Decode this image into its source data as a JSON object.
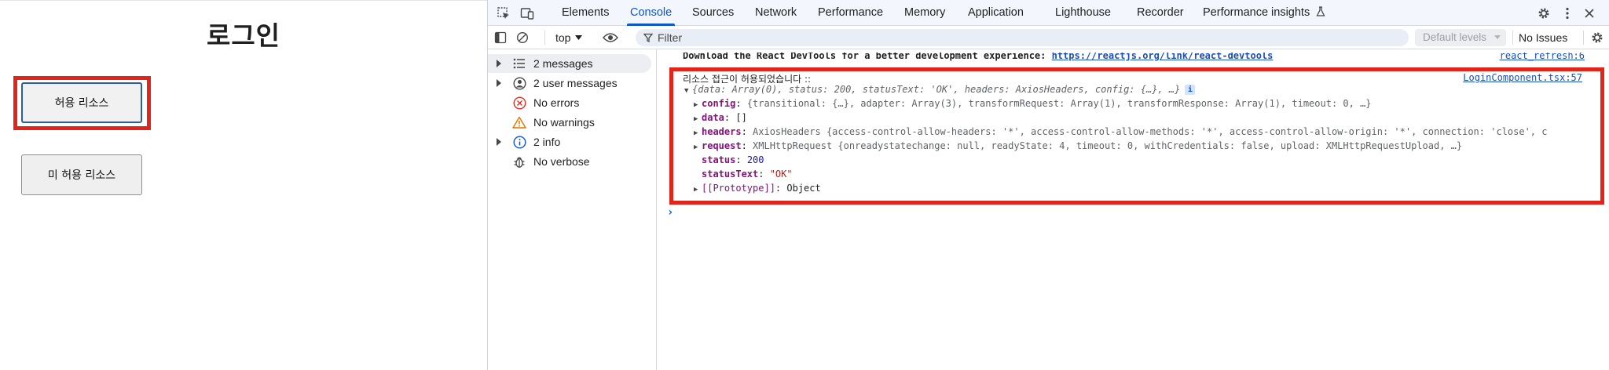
{
  "app": {
    "title": "로그인",
    "buttons": {
      "allowed": "허용 리소스",
      "denied": "미 허용 리소스"
    }
  },
  "devtools": {
    "tabs": [
      "Elements",
      "Console",
      "Sources",
      "Network",
      "Performance",
      "Memory",
      "Application",
      "Lighthouse",
      "Recorder",
      "Performance insights"
    ],
    "active_tab": "Console",
    "toolbar": {
      "context": "top",
      "filter_placeholder": "Filter",
      "levels": "Default levels",
      "issues": "No Issues"
    },
    "sidebar": [
      {
        "label": "2 messages",
        "icon": "list-icon"
      },
      {
        "label": "2 user messages",
        "icon": "user-icon"
      },
      {
        "label": "No errors",
        "icon": "error-icon"
      },
      {
        "label": "No warnings",
        "icon": "warning-icon"
      },
      {
        "label": "2 info",
        "icon": "info-icon"
      },
      {
        "label": "No verbose",
        "icon": "bug-icon"
      }
    ],
    "console": {
      "react_msg": {
        "text": "Download the React DevTools for a better development experience: ",
        "link": "https://reactjs.org/link/react-devtools",
        "source": "react_refresh:6"
      },
      "log": {
        "title": "리소스 접근이 허용되었습니다 ::",
        "source": "LoginComponent.tsx:57",
        "preview": "{data: Array(0), status: 200, statusText: 'OK', headers: AxiosHeaders, config: {…}, …}",
        "config": "{transitional: {…}, adapter: Array(3), transformRequest: Array(1), transformResponse: Array(1), timeout: 0, …}",
        "data": "[]",
        "headers": "AxiosHeaders {access-control-allow-headers: '*', access-control-allow-methods: '*', access-control-allow-origin: '*', connection: 'close', c",
        "request": "XMLHttpRequest {onreadystatechange: null, readyState: 4, timeout: 0, withCredentials: false, upload: XMLHttpRequestUpload, …}",
        "status": "200",
        "statusText": "\"OK\"",
        "prototype": "Object"
      }
    }
  },
  "colors": {
    "highlight": "#e1251b",
    "accent": "#0b57d0"
  }
}
